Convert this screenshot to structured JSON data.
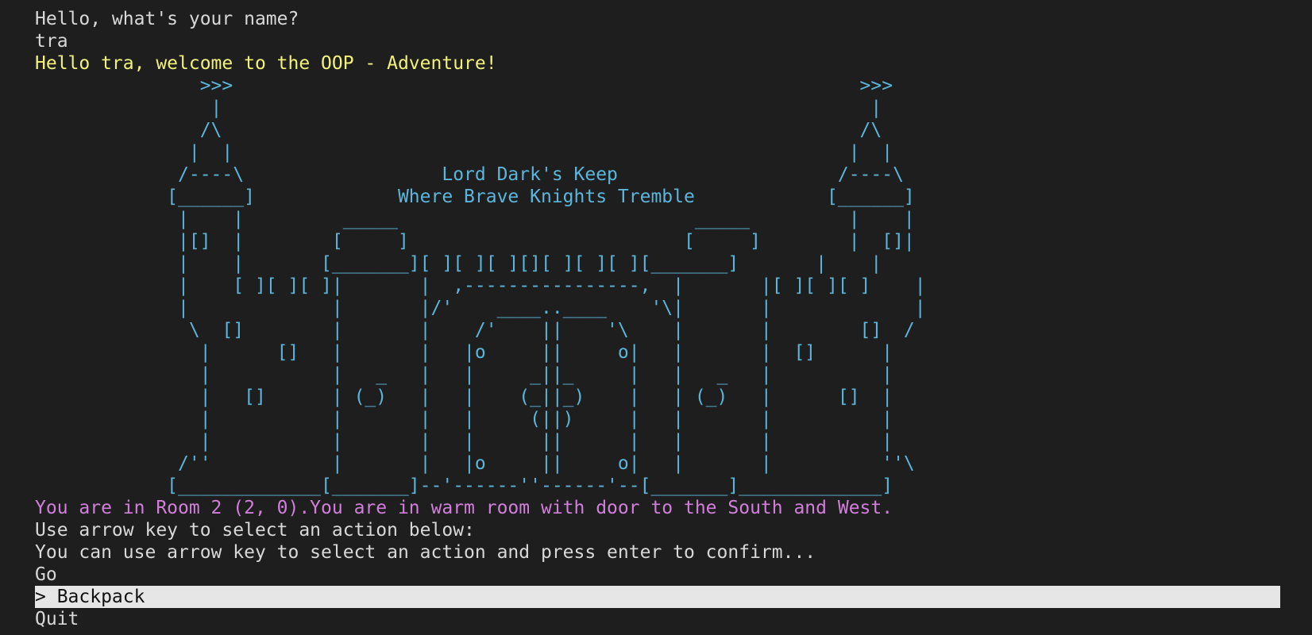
{
  "prompt": "Hello, what's your name?",
  "user_input": "tra",
  "welcome": "Hello tra, welcome to the OOP - Adventure!",
  "castle_art": "               >>>                                                         >>>\n                |                                                           |\n               /\\                                                          /\\\n              |  |                                                        |  |\n             /----\\                  Lord Dark's Keep                    /----\\\n            [______]             Where Brave Knights Tremble            [______]\n             |    |         _____                           _____         |    |\n             |[]  |        [     ]                         [     ]        |  []|\n             |    |       [_______][ ][ ][ ][][ ][ ][ ][_______]       |    |\n             |    [ ][ ][ ]|       |  ,----------------,  |       |[ ][ ][ ]    |\n             |             |       |/'    ____..____    '\\|       |             |\n              \\  []        |       |    /'    ||    '\\    |       |        []  /\n               |      []   |       |   |o     ||     o|   |       |  []      |\n               |           |   _   |   |     _||_     |   |   _   |          |\n               |   []      | (_)   |   |    (_||_)    |   | (_)   |      []  |\n               |           |       |   |     (||)     |   |       |          |\n               |           |       |   |      ||      |   |       |          |\n             /''           |       |   |o     ||     o|   |       |          ''\\\n            [_____________[_______]--'------''------'--[_______]_____________]",
  "room_status": "You are in Room 2 (2, 0).You are in warm room with door to the South and West.",
  "instruction1": "Use arrow key to select an action below:",
  "instruction2": "You can use arrow key to select an action and press enter to confirm...",
  "menu": {
    "items": [
      {
        "label": "Go"
      },
      {
        "label": "> Backpack"
      },
      {
        "label": "Quit"
      }
    ],
    "selected_index": 1
  },
  "colors": {
    "background": "#1e1e1e",
    "text": "#d8d8d8",
    "welcome": "#f2f27a",
    "art": "#5cb6dc",
    "status": "#d27fdc",
    "selection_bg": "#e6e6e6"
  }
}
